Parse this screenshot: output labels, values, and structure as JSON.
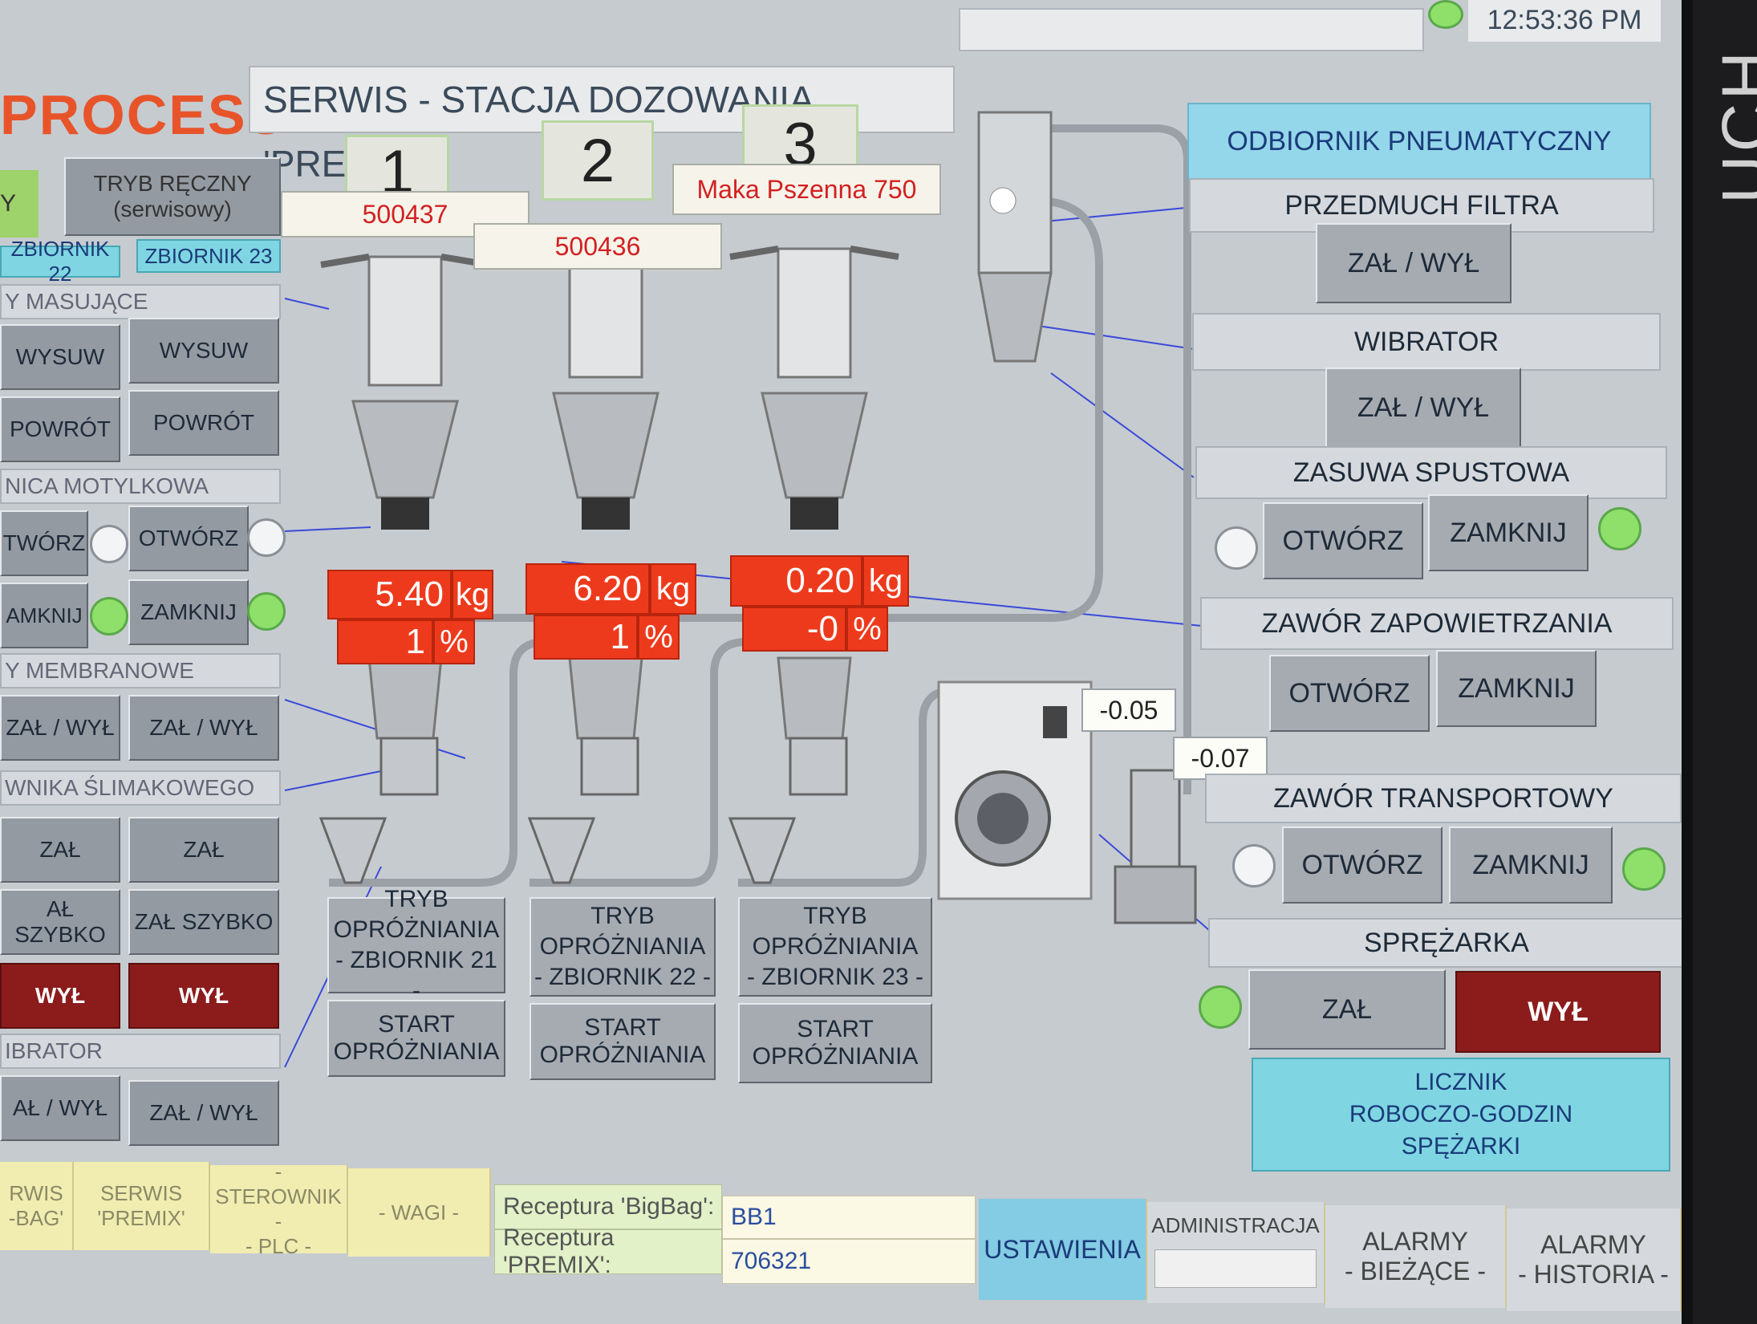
{
  "header": {
    "logo": "PROCESS",
    "title": "SERWIS - STACJA DOZOWANIA 'PREMIX'",
    "clock": "12:53:36 PM"
  },
  "bezel": {
    "brand_text": "UCH"
  },
  "left_panel": {
    "mode_indicator": "Y",
    "manual_mode_button": "TRYB RĘCZNY\n(serwisowy)",
    "tank_tabs": [
      "ZBIORNIK 22",
      "ZBIORNIK 23"
    ],
    "sections": [
      {
        "title": "Y MASUJĄCE",
        "buttons": [
          "WYSUW",
          "WYSUW",
          "POWRÓT",
          "POWRÓT"
        ]
      },
      {
        "title": "NICA MOTYLKOWA",
        "buttons": [
          "TWÓRZ",
          "OTWÓRZ",
          "AMKNIJ",
          "ZAMKNIJ"
        ]
      },
      {
        "title": "Y MEMBRANOWE",
        "buttons": [
          "ZAŁ / WYŁ",
          "ZAŁ / WYŁ"
        ]
      },
      {
        "title": "WNIKA ŚLIMAKOWEGO",
        "buttons": [
          "ZAŁ",
          "ZAŁ",
          "AŁ SZYBKO",
          "ZAŁ SZYBKO",
          "WYŁ",
          "WYŁ"
        ]
      },
      {
        "title": "IBRATOR",
        "buttons": [
          "AŁ / WYŁ",
          "ZAŁ / WYŁ"
        ]
      }
    ]
  },
  "stations": [
    {
      "number": "1",
      "code": "500437",
      "weight": "5.40",
      "weight_unit": "kg",
      "percent": "1",
      "percent_unit": "%",
      "mode_button": "TRYB\nOPRÓŻNIANIA\n- ZBIORNIK 21 -",
      "start_button": "START\nOPRÓŻNIANIA"
    },
    {
      "number": "2",
      "code": "500436",
      "weight": "6.20",
      "weight_unit": "kg",
      "percent": "1",
      "percent_unit": "%",
      "mode_button": "TRYB\nOPRÓŻNIANIA\n- ZBIORNIK 22 -",
      "start_button": "START\nOPRÓŻNIANIA"
    },
    {
      "number": "3",
      "code": "Maka Pszenna 750",
      "weight": "0.20",
      "weight_unit": "kg",
      "percent": "-0",
      "percent_unit": "%",
      "mode_button": "TRYB\nOPRÓŻNIANIA\n- ZBIORNIK 23 -",
      "start_button": "START\nOPRÓŻNIANIA"
    }
  ],
  "readouts": {
    "pressure_1": "-0.05",
    "pressure_2": "-0.07"
  },
  "right_panel": {
    "title": "ODBIORNIK PNEUMATYCZNY",
    "przedmuch": {
      "label": "PRZEDMUCH FILTRA",
      "button": "ZAŁ / WYŁ"
    },
    "wibrator": {
      "label": "WIBRATOR",
      "button": "ZAŁ / WYŁ"
    },
    "zasuwa": {
      "label": "ZASUWA SPUSTOWA",
      "open": "OTWÓRZ",
      "close": "ZAMKNIJ"
    },
    "zawor_zap": {
      "label": "ZAWÓR ZAPOWIETRZANIA",
      "open": "OTWÓRZ",
      "close": "ZAMKNIJ"
    },
    "zawor_trans": {
      "label": "ZAWÓR TRANSPORTOWY",
      "open": "OTWÓRZ",
      "close": "ZAMKNIJ"
    },
    "sprezarka": {
      "label": "SPRĘŻARKA",
      "on": "ZAŁ",
      "off": "WYŁ"
    },
    "counter_button": "LICZNIK\nROBOCZO-GODZIN\nSPĘŻARKI"
  },
  "bottom_bar": {
    "tabs": [
      "RWIS\n-BAG'",
      "SERWIS\n'PREMIX'",
      "- STEROWNIK -\n- PLC -",
      "- WAGI -"
    ],
    "recipe_bigbag_label": "Receptura 'BigBag':",
    "recipe_bigbag_value": "BB1",
    "recipe_premix_label": "Receptura 'PREMIX':",
    "recipe_premix_value": "706321",
    "settings": "USTAWIENIA",
    "admin": "ADMINISTRACJA",
    "alarms_current": "ALARMY\n- BIEŻĄCE -",
    "alarms_history": "ALARMY\n- HISTORIA -"
  },
  "colors": {
    "accent_red": "#ee3a1c",
    "lamp_on": "#8fe06a",
    "cyan": "#7fd6e2",
    "tab_yellow": "#f1ecb0"
  }
}
